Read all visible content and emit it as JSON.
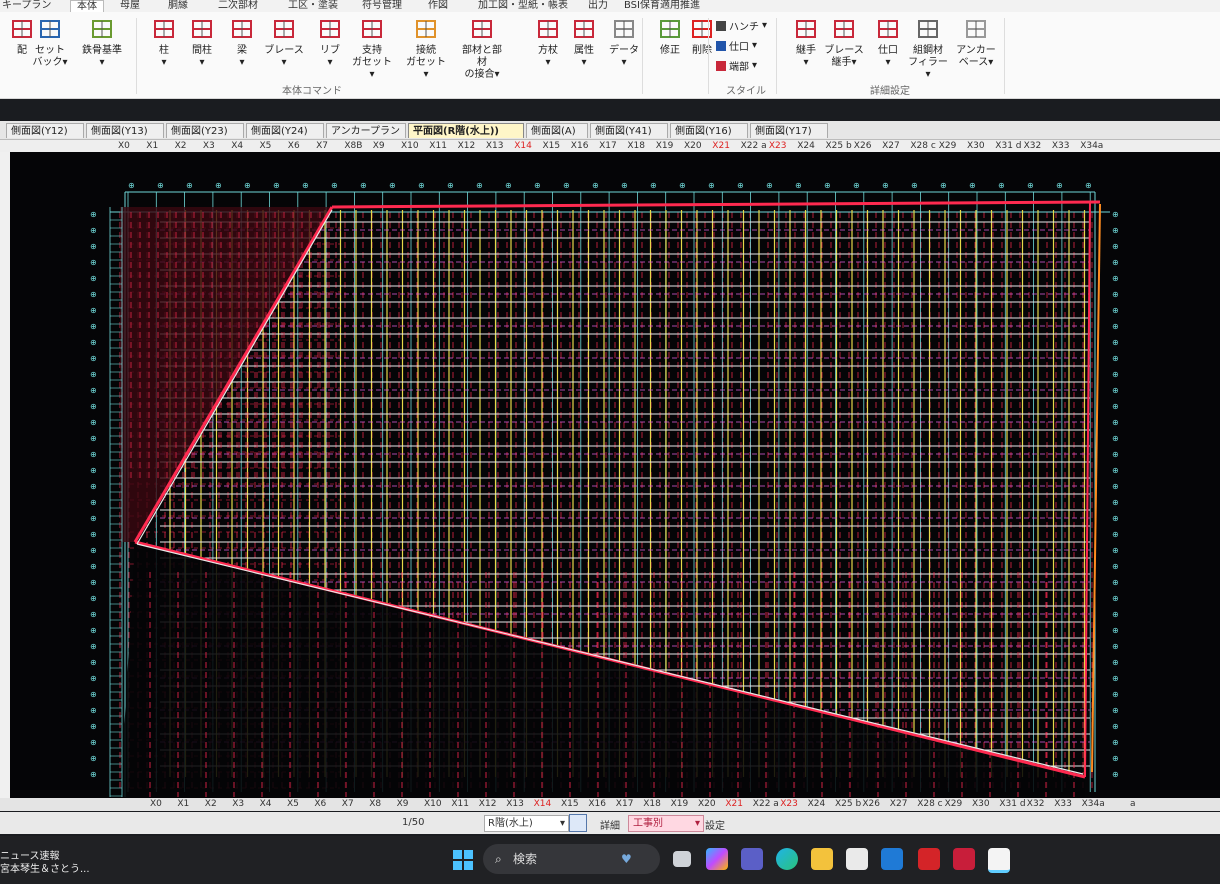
{
  "menu_tabs": [
    "キープラン",
    "本体",
    "母屋",
    "胴縁",
    "二次部材",
    "工区・塗装",
    "符号管理",
    "作図",
    "加工図・型紙・帳表",
    "出力",
    "BSI保育適用推進"
  ],
  "active_menu_tab": "本体",
  "ribbon": {
    "buttons": [
      {
        "key": "haichi",
        "label": "配"
      },
      {
        "key": "setback",
        "label": "セット\nバック▾"
      },
      {
        "key": "kijun",
        "label": "鉄骨基準▾"
      },
      {
        "key": "hashira",
        "label": "柱\n▾"
      },
      {
        "key": "mahashira",
        "label": "間柱\n▾"
      },
      {
        "key": "hari",
        "label": "梁\n▾"
      },
      {
        "key": "brace",
        "label": "ブレース\n▾"
      },
      {
        "key": "rib",
        "label": "リブ\n▾"
      },
      {
        "key": "shiji",
        "label": "支持\nガセット▾"
      },
      {
        "key": "setsuzoku",
        "label": "接続\nガセット▾"
      },
      {
        "key": "setsugo",
        "label": "部材と部材\nの接合▾"
      },
      {
        "key": "hozue",
        "label": "方杖\n▾"
      },
      {
        "key": "zokusei",
        "label": "属性\n▾"
      },
      {
        "key": "data",
        "label": "データ\n▾"
      },
      {
        "key": "shusei",
        "label": "修正"
      },
      {
        "key": "sakujo",
        "label": "削除"
      },
      {
        "key": "tsugite",
        "label": "継手\n▾"
      },
      {
        "key": "brace_tsugite",
        "label": "ブレース\n継手▾"
      },
      {
        "key": "shikuchi",
        "label": "仕口\n▾"
      },
      {
        "key": "kumikou",
        "label": "組鋼材\nフィラー▾"
      },
      {
        "key": "anchor",
        "label": "アンカー\nベース▾"
      }
    ],
    "style_items": [
      "ハンチ",
      "仕口",
      "端部"
    ],
    "groups": [
      "本体コマンド",
      "スタイル",
      "詳細設定"
    ]
  },
  "view_tabs": [
    "側面図(Y12)",
    "側面図(Y13)",
    "側面図(Y23)",
    "側面図(Y24)",
    "アンカープラン",
    "平面図(R階(水上))",
    "側面図(A)",
    "側面図(Y41)",
    "側面図(Y16)",
    "側面図(Y17)"
  ],
  "active_view_tab": "平面図(R階(水上))",
  "grid_labels": [
    "X0",
    "X1",
    "X2",
    "X3",
    "X4",
    "X5",
    "X6",
    "X7",
    "X8B",
    "X9",
    "X10",
    "X11",
    "X12",
    "X13",
    "X14",
    "X15",
    "X16",
    "X17",
    "X18",
    "X19",
    "X20",
    "X21",
    "X22 a",
    "X23",
    "X24",
    "X25 b",
    "X26",
    "X27",
    "X28 c",
    "X29",
    "X30",
    "X31 d",
    "X32",
    "X33",
    "X34a"
  ],
  "grid_labels_bottom": [
    "X0",
    "X1",
    "X2",
    "X3",
    "X4",
    "X5",
    "X6",
    "X7",
    "X8",
    "X9",
    "X10",
    "X11",
    "X12",
    "X13",
    "X14",
    "X15",
    "X16",
    "X17",
    "X18",
    "X19",
    "X20",
    "X21",
    "X22 a",
    "X23",
    "X24",
    "X25 b",
    "X26",
    "X27",
    "X28 c",
    "X29",
    "X30",
    "X31 d",
    "X32",
    "X33",
    "X34a"
  ],
  "red_labels": [
    "X14",
    "X21",
    "X23"
  ],
  "corner_label": "a",
  "status": {
    "scale": "1/50",
    "floor": "R階(水上)",
    "detail_label": "詳細",
    "mode": "工事別",
    "settings_label": "設定"
  },
  "taskbar": {
    "search_placeholder": "検索",
    "news_line1": "ニュース速報",
    "news_line2": "宮本琴生＆さとう..."
  },
  "colors": {
    "canvas_bg": "#050507",
    "grid_cyan": "#6fd8d8",
    "beam_yellow": "#e6d84a",
    "brace_red": "#ff2a50",
    "sub_magenta": "#e060e0",
    "white_line": "#e8e8e8"
  }
}
